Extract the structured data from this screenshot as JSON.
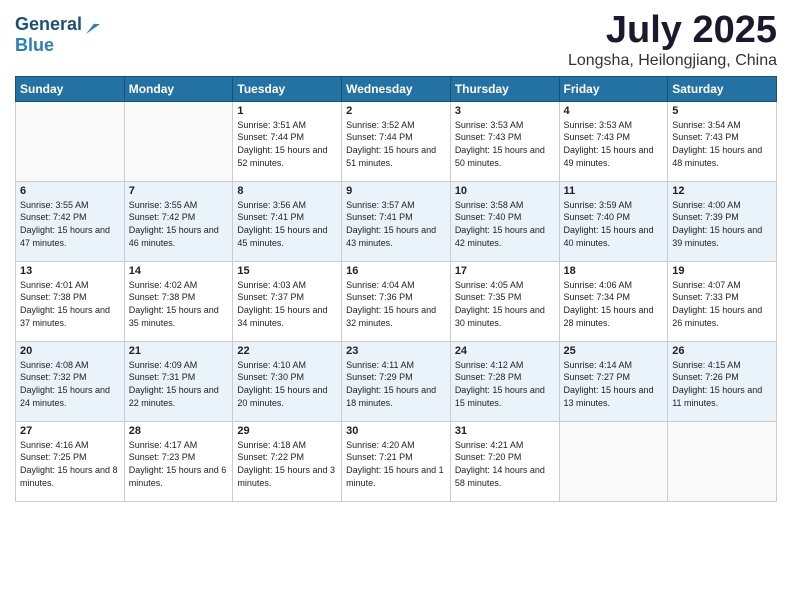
{
  "logo": {
    "line1": "General",
    "line2": "Blue"
  },
  "title": "July 2025",
  "location": "Longsha, Heilongjiang, China",
  "days_of_week": [
    "Sunday",
    "Monday",
    "Tuesday",
    "Wednesday",
    "Thursday",
    "Friday",
    "Saturday"
  ],
  "weeks": [
    [
      {
        "day": "",
        "info": ""
      },
      {
        "day": "",
        "info": ""
      },
      {
        "day": "1",
        "info": "Sunrise: 3:51 AM\nSunset: 7:44 PM\nDaylight: 15 hours and 52 minutes."
      },
      {
        "day": "2",
        "info": "Sunrise: 3:52 AM\nSunset: 7:44 PM\nDaylight: 15 hours and 51 minutes."
      },
      {
        "day": "3",
        "info": "Sunrise: 3:53 AM\nSunset: 7:43 PM\nDaylight: 15 hours and 50 minutes."
      },
      {
        "day": "4",
        "info": "Sunrise: 3:53 AM\nSunset: 7:43 PM\nDaylight: 15 hours and 49 minutes."
      },
      {
        "day": "5",
        "info": "Sunrise: 3:54 AM\nSunset: 7:43 PM\nDaylight: 15 hours and 48 minutes."
      }
    ],
    [
      {
        "day": "6",
        "info": "Sunrise: 3:55 AM\nSunset: 7:42 PM\nDaylight: 15 hours and 47 minutes."
      },
      {
        "day": "7",
        "info": "Sunrise: 3:55 AM\nSunset: 7:42 PM\nDaylight: 15 hours and 46 minutes."
      },
      {
        "day": "8",
        "info": "Sunrise: 3:56 AM\nSunset: 7:41 PM\nDaylight: 15 hours and 45 minutes."
      },
      {
        "day": "9",
        "info": "Sunrise: 3:57 AM\nSunset: 7:41 PM\nDaylight: 15 hours and 43 minutes."
      },
      {
        "day": "10",
        "info": "Sunrise: 3:58 AM\nSunset: 7:40 PM\nDaylight: 15 hours and 42 minutes."
      },
      {
        "day": "11",
        "info": "Sunrise: 3:59 AM\nSunset: 7:40 PM\nDaylight: 15 hours and 40 minutes."
      },
      {
        "day": "12",
        "info": "Sunrise: 4:00 AM\nSunset: 7:39 PM\nDaylight: 15 hours and 39 minutes."
      }
    ],
    [
      {
        "day": "13",
        "info": "Sunrise: 4:01 AM\nSunset: 7:38 PM\nDaylight: 15 hours and 37 minutes."
      },
      {
        "day": "14",
        "info": "Sunrise: 4:02 AM\nSunset: 7:38 PM\nDaylight: 15 hours and 35 minutes."
      },
      {
        "day": "15",
        "info": "Sunrise: 4:03 AM\nSunset: 7:37 PM\nDaylight: 15 hours and 34 minutes."
      },
      {
        "day": "16",
        "info": "Sunrise: 4:04 AM\nSunset: 7:36 PM\nDaylight: 15 hours and 32 minutes."
      },
      {
        "day": "17",
        "info": "Sunrise: 4:05 AM\nSunset: 7:35 PM\nDaylight: 15 hours and 30 minutes."
      },
      {
        "day": "18",
        "info": "Sunrise: 4:06 AM\nSunset: 7:34 PM\nDaylight: 15 hours and 28 minutes."
      },
      {
        "day": "19",
        "info": "Sunrise: 4:07 AM\nSunset: 7:33 PM\nDaylight: 15 hours and 26 minutes."
      }
    ],
    [
      {
        "day": "20",
        "info": "Sunrise: 4:08 AM\nSunset: 7:32 PM\nDaylight: 15 hours and 24 minutes."
      },
      {
        "day": "21",
        "info": "Sunrise: 4:09 AM\nSunset: 7:31 PM\nDaylight: 15 hours and 22 minutes."
      },
      {
        "day": "22",
        "info": "Sunrise: 4:10 AM\nSunset: 7:30 PM\nDaylight: 15 hours and 20 minutes."
      },
      {
        "day": "23",
        "info": "Sunrise: 4:11 AM\nSunset: 7:29 PM\nDaylight: 15 hours and 18 minutes."
      },
      {
        "day": "24",
        "info": "Sunrise: 4:12 AM\nSunset: 7:28 PM\nDaylight: 15 hours and 15 minutes."
      },
      {
        "day": "25",
        "info": "Sunrise: 4:14 AM\nSunset: 7:27 PM\nDaylight: 15 hours and 13 minutes."
      },
      {
        "day": "26",
        "info": "Sunrise: 4:15 AM\nSunset: 7:26 PM\nDaylight: 15 hours and 11 minutes."
      }
    ],
    [
      {
        "day": "27",
        "info": "Sunrise: 4:16 AM\nSunset: 7:25 PM\nDaylight: 15 hours and 8 minutes."
      },
      {
        "day": "28",
        "info": "Sunrise: 4:17 AM\nSunset: 7:23 PM\nDaylight: 15 hours and 6 minutes."
      },
      {
        "day": "29",
        "info": "Sunrise: 4:18 AM\nSunset: 7:22 PM\nDaylight: 15 hours and 3 minutes."
      },
      {
        "day": "30",
        "info": "Sunrise: 4:20 AM\nSunset: 7:21 PM\nDaylight: 15 hours and 1 minute."
      },
      {
        "day": "31",
        "info": "Sunrise: 4:21 AM\nSunset: 7:20 PM\nDaylight: 14 hours and 58 minutes."
      },
      {
        "day": "",
        "info": ""
      },
      {
        "day": "",
        "info": ""
      }
    ]
  ]
}
